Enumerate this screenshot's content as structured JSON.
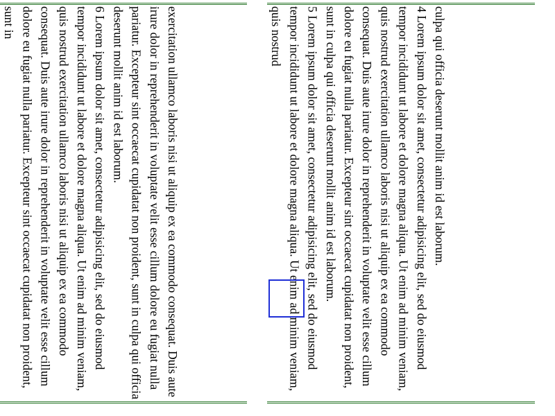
{
  "document": {
    "right_column": {
      "lead_text": "culpa qui officia deserunt mollit anim id est laborum.",
      "paragraphs": [
        {
          "text": "4 Lorem ipsum dolor sit amet, consectetur adipisicing elit, sed do eiusmod tempor incididunt ut labore et dolore magna aliqua. Ut enim ad minim veniam, quis nostrud exercitation ullamco laboris nisi ut aliquip ex ea commodo consequat. Duis aute irure dolor in reprehenderit in voluptate velit esse cillum dolore eu fugiat nulla pariatur. Excepteur sint occaecat cupidatat non proident, sunt in culpa qui officia deserunt mollit anim id est laborum."
        },
        {
          "text": "5 Lorem ipsum dolor sit amet, consectetur adipisicing elit, sed do eiusmod tempor incididunt ut labore et dolore magna aliqua. Ut enim ad minim veniam, quis nostrud"
        }
      ]
    },
    "left_column": {
      "lead_text": "exercitation ullamco laboris nisi ut aliquip ex ea commodo consequat. Duis aute irure dolor in reprehenderit in voluptate velit esse cillum dolore eu fugiat nulla pariatur. Excepteur sint occaecat cupidatat non proident, sunt in culpa qui officia deserunt mollit anim id est laborum.",
      "paragraphs": [
        {
          "text": "6 Lorem ipsum dolor sit amet, consectetur adipisicing elit, sed do eiusmod tempor incididunt ut labore et dolore magna aliqua. Ut enim ad minim veniam, quis nostrud exercitation ullamco laboris nisi ut aliquip ex ea commodo consequat. Duis aute irure dolor in reprehenderit in voluptate velit esse cillum dolore eu fugiat nulla pariatur. Excepteur sint occaecat cupidatat non proident, sunt in"
        }
      ]
    }
  },
  "colors": {
    "rule": "#2f7a2f",
    "selection": "#1f2fd6",
    "text": "#000000",
    "background": "#ffffff"
  }
}
